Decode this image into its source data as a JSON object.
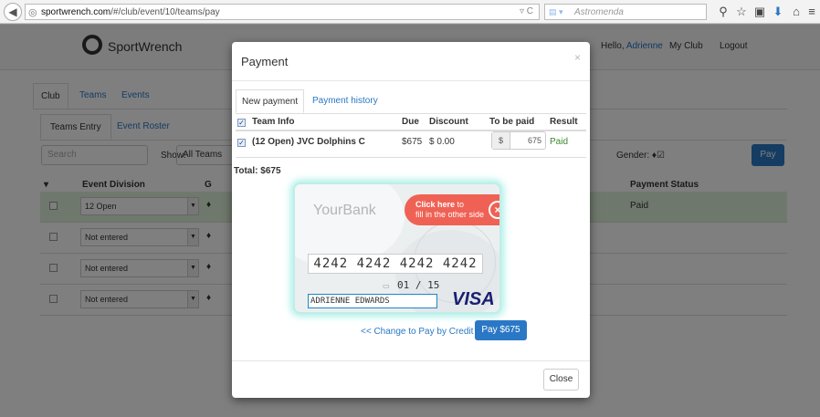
{
  "browser": {
    "url_host": "sportwrench.com",
    "url_path": "/#/club/event/10/teams/pay",
    "search_engine": "▾",
    "search_placeholder": "Astromenda"
  },
  "nav": {
    "brand": "SportWrench",
    "hello": "Hello,",
    "user": "Adrienne",
    "my_club": "My Club",
    "logout": "Logout"
  },
  "tabs": [
    "Club",
    "Teams",
    "Events"
  ],
  "subtabs": [
    "Teams Entry",
    "Event Roster"
  ],
  "filter": {
    "search_placeholder": "Search",
    "show_label": "Show:",
    "show_value": "All Teams",
    "gender_label": "Gender:",
    "pay_label": "Pay"
  },
  "grid": {
    "headers": [
      "Event Division",
      "G",
      "Payment Status"
    ],
    "rows": [
      {
        "division": "12 Open",
        "status": "Paid"
      },
      {
        "division": "Not entered",
        "status": ""
      },
      {
        "division": "Not entered",
        "status": ""
      },
      {
        "division": "Not entered",
        "status": ""
      }
    ]
  },
  "modal": {
    "title": "Payment",
    "close_x": "×",
    "tabs": {
      "new_payment": "New payment",
      "history": "Payment history"
    },
    "headers": {
      "team_info": "Team Info",
      "due": "Due",
      "discount": "Discount",
      "to_be_paid": "To be paid",
      "result": "Result"
    },
    "row": {
      "team": "(12 Open) JVC Dolphins C",
      "due": "$675",
      "discount": "$ 0.00",
      "currency": "$",
      "to_be_paid": "675",
      "result": "Paid"
    },
    "total": "Total: $675",
    "card": {
      "bank": "YourBank",
      "click_here": "Click here",
      "to": "to",
      "fill_other_side": "fill in the other side",
      "number": "4242 4242 4242 4242",
      "expiry": "01 / 15",
      "holder": "ADRIENNE EDWARDS",
      "brand": "VISA"
    },
    "change_link": "<< Change to Pay by Credit",
    "pay_button": "Pay $675",
    "close_button": "Close"
  },
  "colors": {
    "link": "#2a78c5",
    "paid_green": "#3c8a2e",
    "paid_row_bg": "#dff0d8",
    "click_here_bg": "#f06155"
  }
}
